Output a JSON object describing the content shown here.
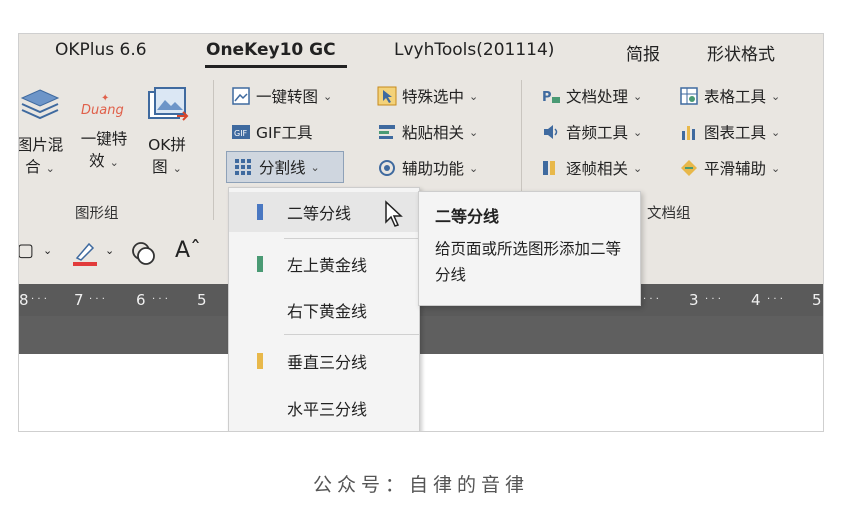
{
  "tabs": [
    "OKPlus 6.6",
    "OneKey10 GC",
    "LvyhTools(201114)",
    "简报",
    "形状格式"
  ],
  "graphics_group": {
    "label": "图形组",
    "big_buttons": [
      {
        "label_line1": "图片混",
        "label_line2": "合",
        "icon": "layers-icon"
      },
      {
        "label_line1": "一键特",
        "label_line2": "效",
        "icon": "duang-icon",
        "icon_text": "Duang"
      },
      {
        "label_line1": "OK拼",
        "label_line2": "图",
        "icon": "image-collage-icon"
      }
    ]
  },
  "ribbon_buttons": {
    "col1": [
      "一键转图",
      "GIF工具",
      "分割线"
    ],
    "col2": [
      "特殊选中",
      "粘贴相关",
      "辅助功能"
    ],
    "col3": [
      "文档处理",
      "音频工具",
      "逐帧相关"
    ],
    "col4": [
      "表格工具",
      "图表工具",
      "平滑辅助"
    ]
  },
  "doc_group": {
    "label": "文档组"
  },
  "ruler_ticks_left": [
    "8",
    "7",
    "6",
    "5"
  ],
  "ruler_ticks_right": [
    "3",
    "4",
    "5"
  ],
  "menu": {
    "items": [
      {
        "label": "二等分线",
        "marker": "#4a78c2"
      },
      {
        "label": "左上黄金线",
        "marker": "#4a9a74"
      },
      {
        "label": "右下黄金线",
        "marker": ""
      },
      {
        "label": "垂直三分线",
        "marker": "#e8b84a"
      },
      {
        "label": "水平三分线",
        "marker": ""
      }
    ]
  },
  "tooltip": {
    "title": "二等分线",
    "body": "给页面或所选图形添加二等分线"
  },
  "caption": "公众号：自律的音律"
}
